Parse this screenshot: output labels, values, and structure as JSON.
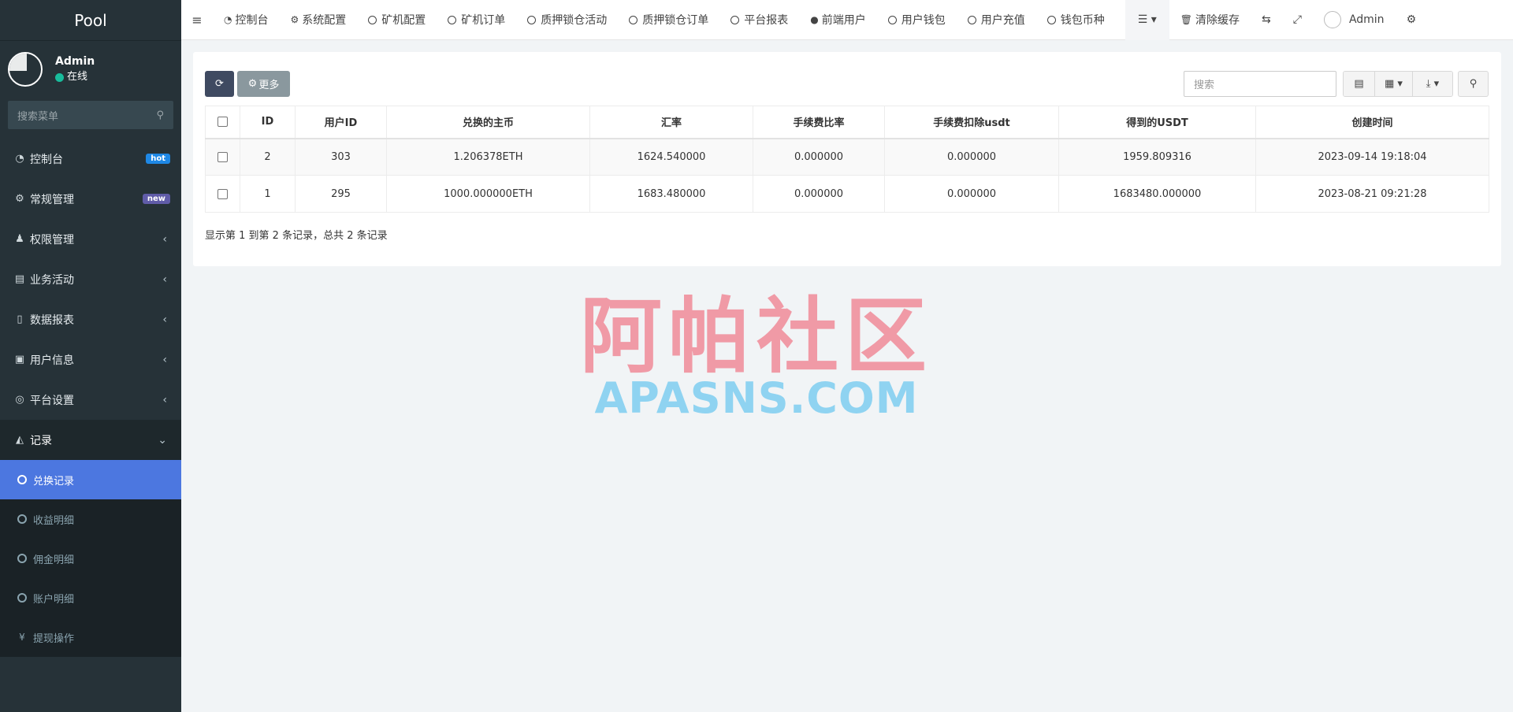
{
  "sidebar": {
    "logo": "Pool",
    "user": {
      "name": "Admin",
      "status": "在线"
    },
    "search_placeholder": "搜索菜单",
    "items": [
      {
        "label": "控制台",
        "badge": "hot"
      },
      {
        "label": "常规管理",
        "badge": "new"
      },
      {
        "label": "权限管理"
      },
      {
        "label": "业务活动"
      },
      {
        "label": "数据报表"
      },
      {
        "label": "用户信息"
      },
      {
        "label": "平台设置"
      },
      {
        "label": "记录"
      }
    ],
    "subitems": [
      {
        "label": "兑换记录"
      },
      {
        "label": "收益明细"
      },
      {
        "label": "佣金明细"
      },
      {
        "label": "账户明细"
      },
      {
        "label": "提现操作"
      }
    ]
  },
  "topnav": {
    "items": [
      "控制台",
      "系统配置",
      "矿机配置",
      "矿机订单",
      "质押锁仓活动",
      "质押锁仓订单",
      "平台报表",
      "前端用户",
      "用户钱包",
      "用户充值",
      "钱包币种"
    ],
    "clear_cache": "清除缓存",
    "admin": "Admin"
  },
  "toolbar": {
    "more_label": "更多",
    "search_placeholder": "搜索"
  },
  "table": {
    "headers": [
      "ID",
      "用户ID",
      "兑换的主币",
      "汇率",
      "手续费比率",
      "手续费扣除usdt",
      "得到的USDT",
      "创建时间"
    ],
    "rows": [
      [
        "2",
        "303",
        "1.206378ETH",
        "1624.540000",
        "0.000000",
        "0.000000",
        "1959.809316",
        "2023-09-14 19:18:04"
      ],
      [
        "1",
        "295",
        "1000.000000ETH",
        "1683.480000",
        "0.000000",
        "0.000000",
        "1683480.000000",
        "2023-08-21 09:21:28"
      ]
    ]
  },
  "pagination": "显示第 1 到第 2 条记录，总共 2 条记录",
  "watermark": {
    "cn": "阿帕社区",
    "en": "APASNS.COM"
  },
  "colors": {
    "sidebar": "#263238",
    "active": "#4c77e0",
    "hot": "#1e88e5",
    "new": "#605ca8",
    "refresh_btn": "#3f4a61"
  }
}
